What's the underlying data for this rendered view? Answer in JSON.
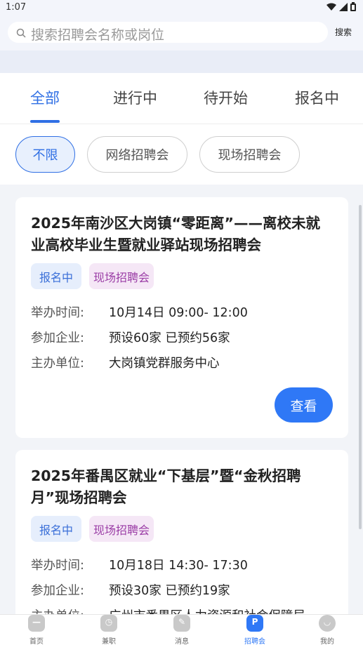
{
  "status_bar": {
    "time": "1:07",
    "icons": [
      "wifi-icon",
      "signal-icon",
      "battery-icon"
    ]
  },
  "search": {
    "placeholder": "搜索招聘会名称或岗位",
    "button_label": "搜索"
  },
  "tabs": [
    {
      "label": "全部",
      "active": true
    },
    {
      "label": "进行中",
      "active": false
    },
    {
      "label": "待开始",
      "active": false
    },
    {
      "label": "报名中",
      "active": false
    }
  ],
  "filters": [
    {
      "label": "不限",
      "active": true
    },
    {
      "label": "网络招聘会",
      "active": false
    },
    {
      "label": "现场招聘会",
      "active": false
    }
  ],
  "cards": [
    {
      "title": "2025年南沙区大岗镇“零距离”——离校未就业高校毕业生暨就业驿站现场招聘会",
      "status_tag": "报名中",
      "type_tag": "现场招聘会",
      "rows": [
        {
          "label": "举办时间:",
          "value": "10月14日 09:00- 12:00"
        },
        {
          "label": "参加企业:",
          "value": "预设60家 已预约56家"
        },
        {
          "label": "主办单位:",
          "value": "大岗镇党群服务中心"
        }
      ],
      "button_label": "查看"
    },
    {
      "title": "2025年番禺区就业“下基层”暨“金秋招聘月”现场招聘会",
      "status_tag": "报名中",
      "type_tag": "现场招聘会",
      "rows": [
        {
          "label": "举办时间:",
          "value": "10月18日 14:30- 17:30"
        },
        {
          "label": "参加企业:",
          "value": "预设30家 已预约19家"
        },
        {
          "label": "主办单位:",
          "value": "广州市番禺区人力资源和社会保障局"
        }
      ]
    }
  ],
  "bottom_nav": [
    {
      "label": "首页",
      "icon": "home-icon",
      "active": false
    },
    {
      "label": "兼职",
      "icon": "clock-icon",
      "active": false
    },
    {
      "label": "消息",
      "icon": "message-icon",
      "active": false
    },
    {
      "label": "招聘会",
      "icon": "fair-icon",
      "active": true
    },
    {
      "label": "我的",
      "icon": "profile-icon",
      "active": false
    }
  ],
  "colors": {
    "accent": "#2f78f6",
    "tag_status_bg": "#e6eefc",
    "tag_type_bg": "#f5e7f6"
  }
}
